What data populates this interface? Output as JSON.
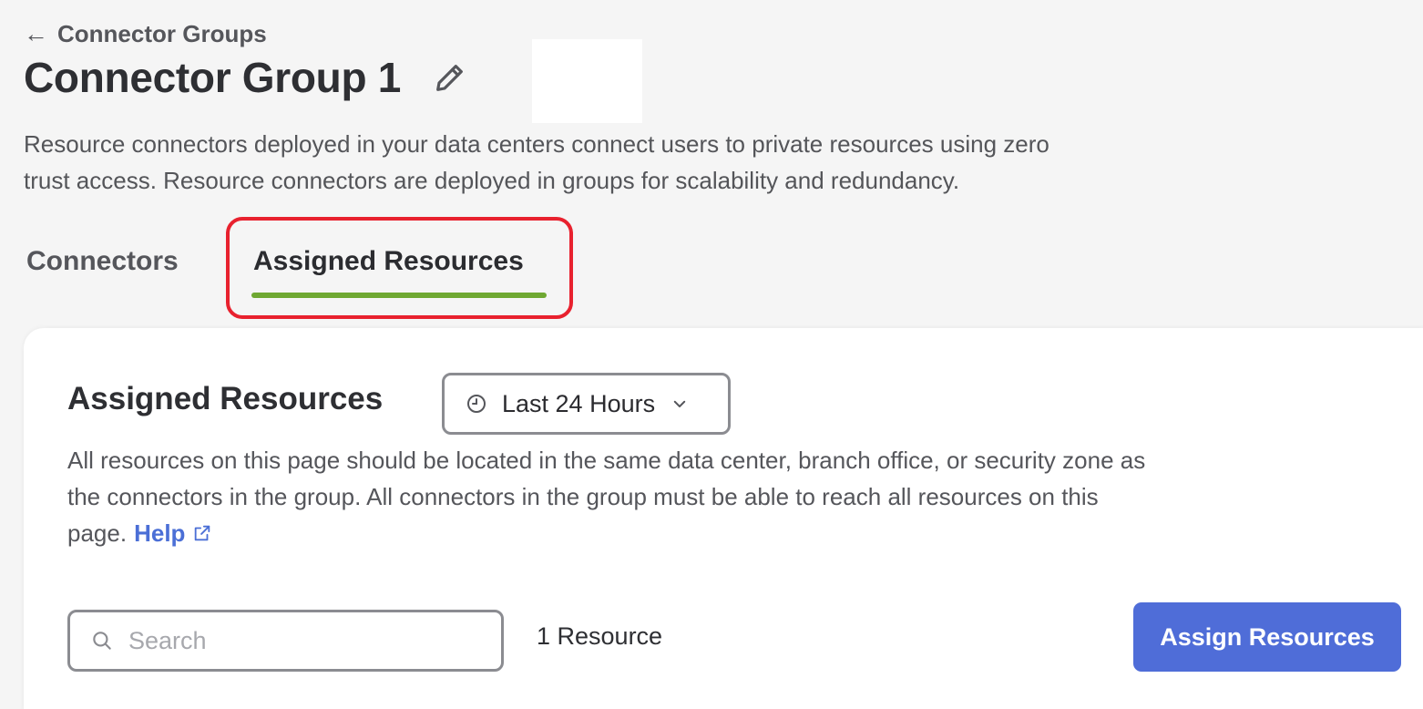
{
  "breadcrumb": {
    "back_label": "Connector Groups"
  },
  "header": {
    "title": "Connector Group 1",
    "description": "Resource connectors deployed in your data centers connect users to private resources using zero trust access. Resource connectors are deployed in groups for scalability and redundancy."
  },
  "tabs": [
    {
      "label": "Connectors",
      "active": false
    },
    {
      "label": "Assigned Resources",
      "active": true
    }
  ],
  "card": {
    "title": "Assigned Resources",
    "time_filter": {
      "selected": "Last 24 Hours"
    },
    "description": "All resources on this page should be located in the same data center, branch office, or security zone as the connectors in the group. All connectors in the group must be able to reach all resources on this page.",
    "help_label": "Help",
    "search": {
      "placeholder": "Search",
      "value": ""
    },
    "resource_count": "1 Resource",
    "assign_button": "Assign Resources"
  },
  "icons": {
    "back": "arrow-left-icon",
    "edit": "pencil-icon",
    "clock": "clock-icon",
    "chevron": "chevron-down-icon",
    "external": "external-link-icon",
    "search": "search-icon"
  },
  "colors": {
    "tab_underline": "#6fa832",
    "highlight": "#e8212e",
    "primary_button": "#4f6dd8",
    "link": "#4b6fd6"
  }
}
